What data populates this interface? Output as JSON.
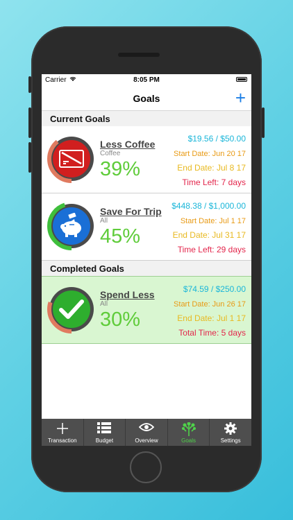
{
  "status_bar": {
    "carrier": "Carrier",
    "time": "8:05 PM"
  },
  "nav": {
    "title": "Goals",
    "add_label": "+"
  },
  "sections": {
    "current": "Current Goals",
    "completed": "Completed Goals"
  },
  "goals": [
    {
      "name": "Less Coffee",
      "category": "Coffee",
      "percent": "39%",
      "progress": 0.39,
      "amounts": "$19.56 / $50.00",
      "start": "Start Date: Jun 20 17",
      "end": "End Date: Jul 8 17",
      "time_left": "Time Left: 7 days",
      "icon": "credit-card-icon",
      "ring_color": "#e07a5f",
      "fill_color": "#d11f1f"
    },
    {
      "name": "Save For Trip",
      "category": "All",
      "percent": "45%",
      "progress": 0.45,
      "amounts": "$448.38 / $1,000.00",
      "start": "Start Date: Jul 1 17",
      "end": "End Date: Jul 31 17",
      "time_left": "Time Left: 29 days",
      "icon": "piggy-bank-icon",
      "ring_color": "#3fbf3c",
      "fill_color": "#1a6fd6"
    },
    {
      "name": "Spend Less",
      "category": "All",
      "percent": "30%",
      "progress": 0.3,
      "amounts": "$74.59 / $250.00",
      "start": "Start Date: Jun 26 17",
      "end": "End Date: Jul 1 17",
      "time_left": "Total Time: 5 days",
      "icon": "checkmark-icon",
      "ring_color": "#e07a5f",
      "fill_color": "#2eae2e"
    }
  ],
  "tabs": [
    {
      "label": "Transaction",
      "icon": "plus-icon"
    },
    {
      "label": "Budget",
      "icon": "list-icon"
    },
    {
      "label": "Overview",
      "icon": "eye-icon"
    },
    {
      "label": "Goals",
      "icon": "tree-icon",
      "active": true
    },
    {
      "label": "Settings",
      "icon": "gear-icon"
    }
  ],
  "colors": {
    "accent_blue": "#1b7ee6",
    "percent_green": "#5fcc3a",
    "amount_cyan": "#1ab6d9",
    "date_orange": "#e89a14",
    "time_red": "#e3254b",
    "completed_bg": "#d9f6d1"
  }
}
